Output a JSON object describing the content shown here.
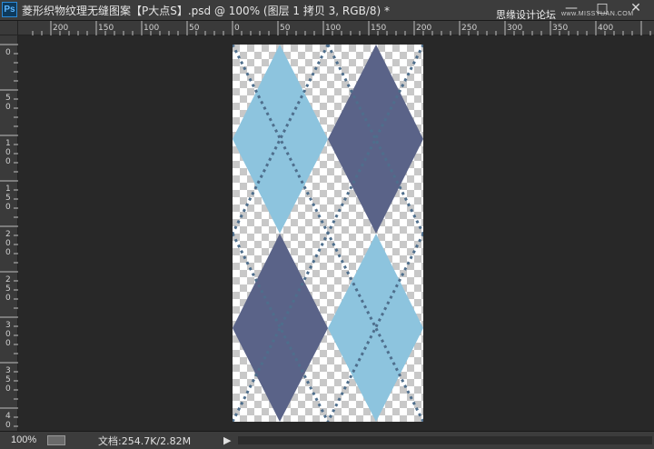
{
  "app": {
    "logo": "Ps"
  },
  "window": {
    "title": "菱形织物纹理无缝图案【P大点S】.psd @ 100% (图层 1 拷贝 3, RGB/8) *",
    "minimize": "—",
    "maximize": "□",
    "close": "✕",
    "watermark": "思缘设计论坛",
    "watermark_url": "www.MISSYUAN.COM"
  },
  "ruler_h": {
    "ticks": [
      "200",
      "150",
      "100",
      "50",
      "0",
      "50",
      "100",
      "150",
      "200",
      "250",
      "300",
      "350",
      "400"
    ]
  },
  "ruler_v": {
    "ticks": [
      "0",
      "50",
      "100",
      "150",
      "200",
      "250",
      "300",
      "350",
      "40"
    ]
  },
  "document": {
    "colors": {
      "light_diamond": "#8dc4de",
      "dark_diamond": "#5a6388",
      "stitch": "#4e6e8c",
      "checker_a": "#ffffff",
      "checker_b": "#c8c8c8"
    }
  },
  "status": {
    "zoom": "100%",
    "doc_info": "文档:254.7K/2.82M",
    "arrow": "▶"
  },
  "icons": {
    "status": "navigator-icon",
    "arrow": "menu-arrow-icon"
  }
}
